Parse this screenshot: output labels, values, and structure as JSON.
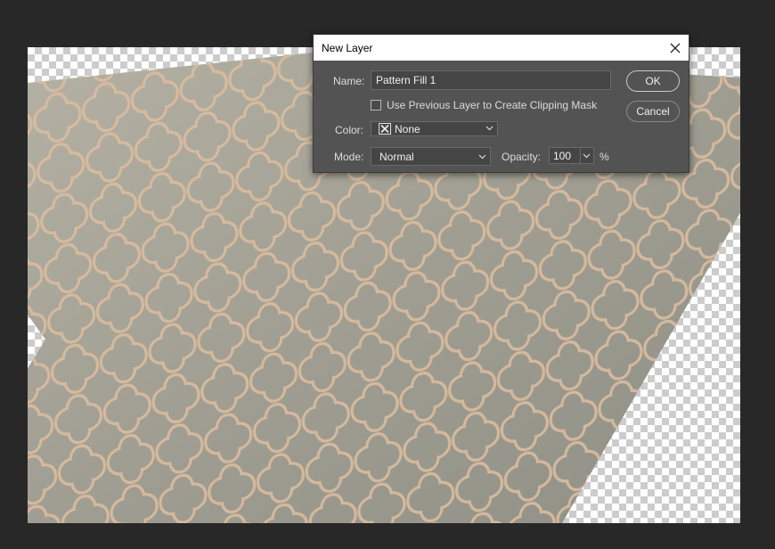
{
  "dialog": {
    "title": "New Layer",
    "name_label": "Name:",
    "name_value": "Pattern Fill 1",
    "clipping_mask_label": "Use Previous Layer to Create Clipping Mask",
    "clipping_mask_checked": false,
    "color_label": "Color:",
    "color_value": "None",
    "mode_label": "Mode:",
    "mode_value": "Normal",
    "opacity_label": "Opacity:",
    "opacity_value": "100",
    "opacity_unit": "%",
    "ok_label": "OK",
    "cancel_label": "Cancel"
  },
  "canvas": {
    "content": "rug-with-transparency",
    "rug_color": "#9a9a8e",
    "pattern_color": "#d8b89a"
  },
  "icons": {
    "close": "close-icon",
    "color_swatch": "x-swatch-icon",
    "dropdown": "chevron-down-icon"
  },
  "colors": {
    "workspace_bg": "#282828",
    "dialog_bg": "#535353",
    "titlebar_bg": "#ffffff"
  }
}
